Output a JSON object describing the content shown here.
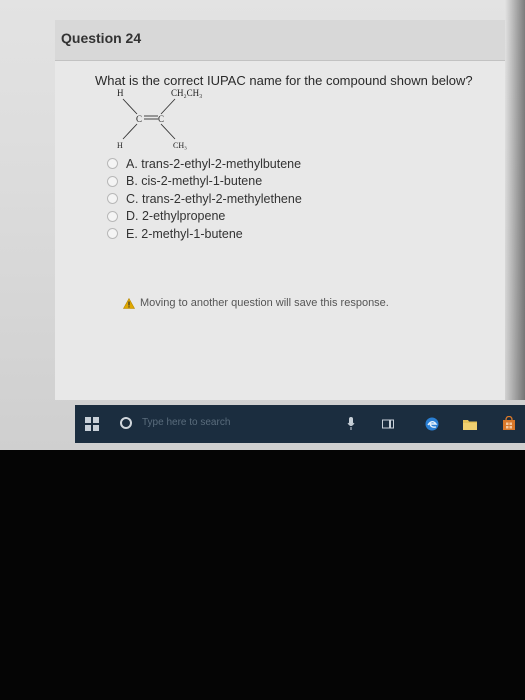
{
  "question": {
    "title": "Question 24",
    "prompt": "What is the correct IUPAC name for the compound shown below?",
    "molecule": {
      "top_left": "H",
      "top_right": "CH₂CH₃",
      "bottom_left": "H",
      "bottom_right": "CH₃",
      "left_c": "C",
      "right_c": "C"
    },
    "options": [
      {
        "label": "A. trans-2-ethyl-2-methylbutene"
      },
      {
        "label": "B. cis-2-methyl-1-butene"
      },
      {
        "label": "C. trans-2-ethyl-2-methylethene"
      },
      {
        "label": "D. 2-ethylpropene"
      },
      {
        "label": "E. 2-methyl-1-butene"
      }
    ],
    "warning": "Moving to another question will save this response."
  },
  "taskbar": {
    "search_placeholder": "Type here to search"
  },
  "colors": {
    "taskbar_bg": "#1b2d3f",
    "edge_blue": "#2a7fd4",
    "store_orange": "#d8782a",
    "warning_yellow": "#e0a800"
  }
}
